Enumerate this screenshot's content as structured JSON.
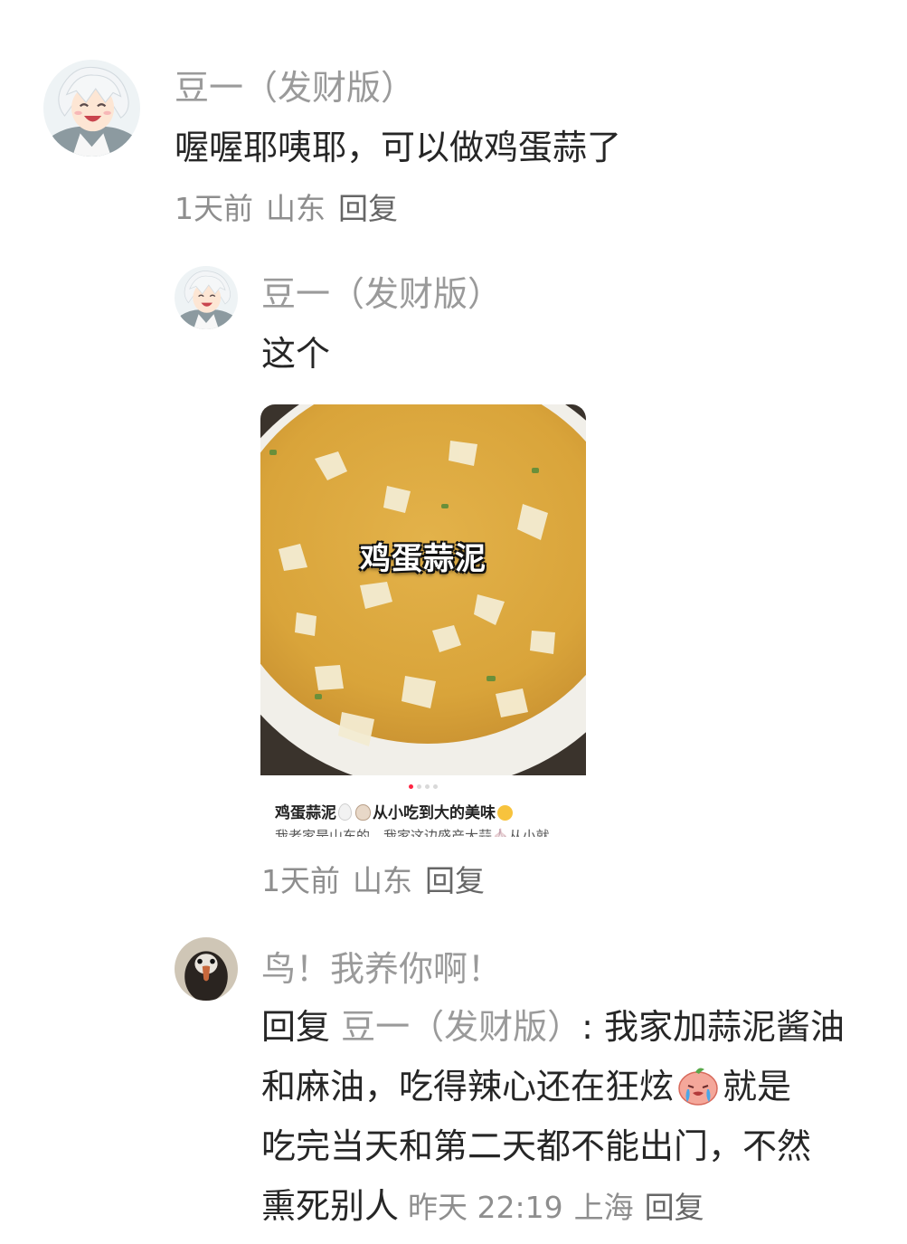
{
  "comments": [
    {
      "name": "豆一（发财版）",
      "text": "喔喔耶咦耶，可以做鸡蛋蒜了",
      "time": "1天前",
      "location": "山东",
      "reply_label": "回复",
      "avatar_icon": "anime-character-avatar-icon"
    },
    {
      "name": "豆一（发财版）",
      "text": "这个",
      "time": "1天前",
      "location": "山东",
      "reply_label": "回复",
      "avatar_icon": "anime-character-avatar-icon",
      "card": {
        "overlay_title": "鸡蛋蒜泥",
        "title_part1": "鸡蛋蒜泥",
        "title_part2": "从小吃到大的美味",
        "description": "我老家是山东的，我家这边盛产大蒜🧄从小就"
      }
    },
    {
      "name": "鸟！我养你啊！",
      "reply_prefix": "回复",
      "reply_to": "豆一（发财版）",
      "text_line1": ": 我家加蒜泥酱油",
      "text_line2a": "和麻油，吃得辣心还在狂炫",
      "text_line2b": "就是",
      "text_line3": "吃完当天和第二天都不能出门，不然",
      "text_line4": "熏死别人",
      "time": "昨天 22:19",
      "location": "上海",
      "reply_label": "回复",
      "avatar_icon": "bird-avatar-icon"
    }
  ],
  "colors": {
    "name": "#9a9a9a",
    "body": "#262626",
    "meta": "#8e8e8e",
    "pager_active": "#ff2442"
  }
}
